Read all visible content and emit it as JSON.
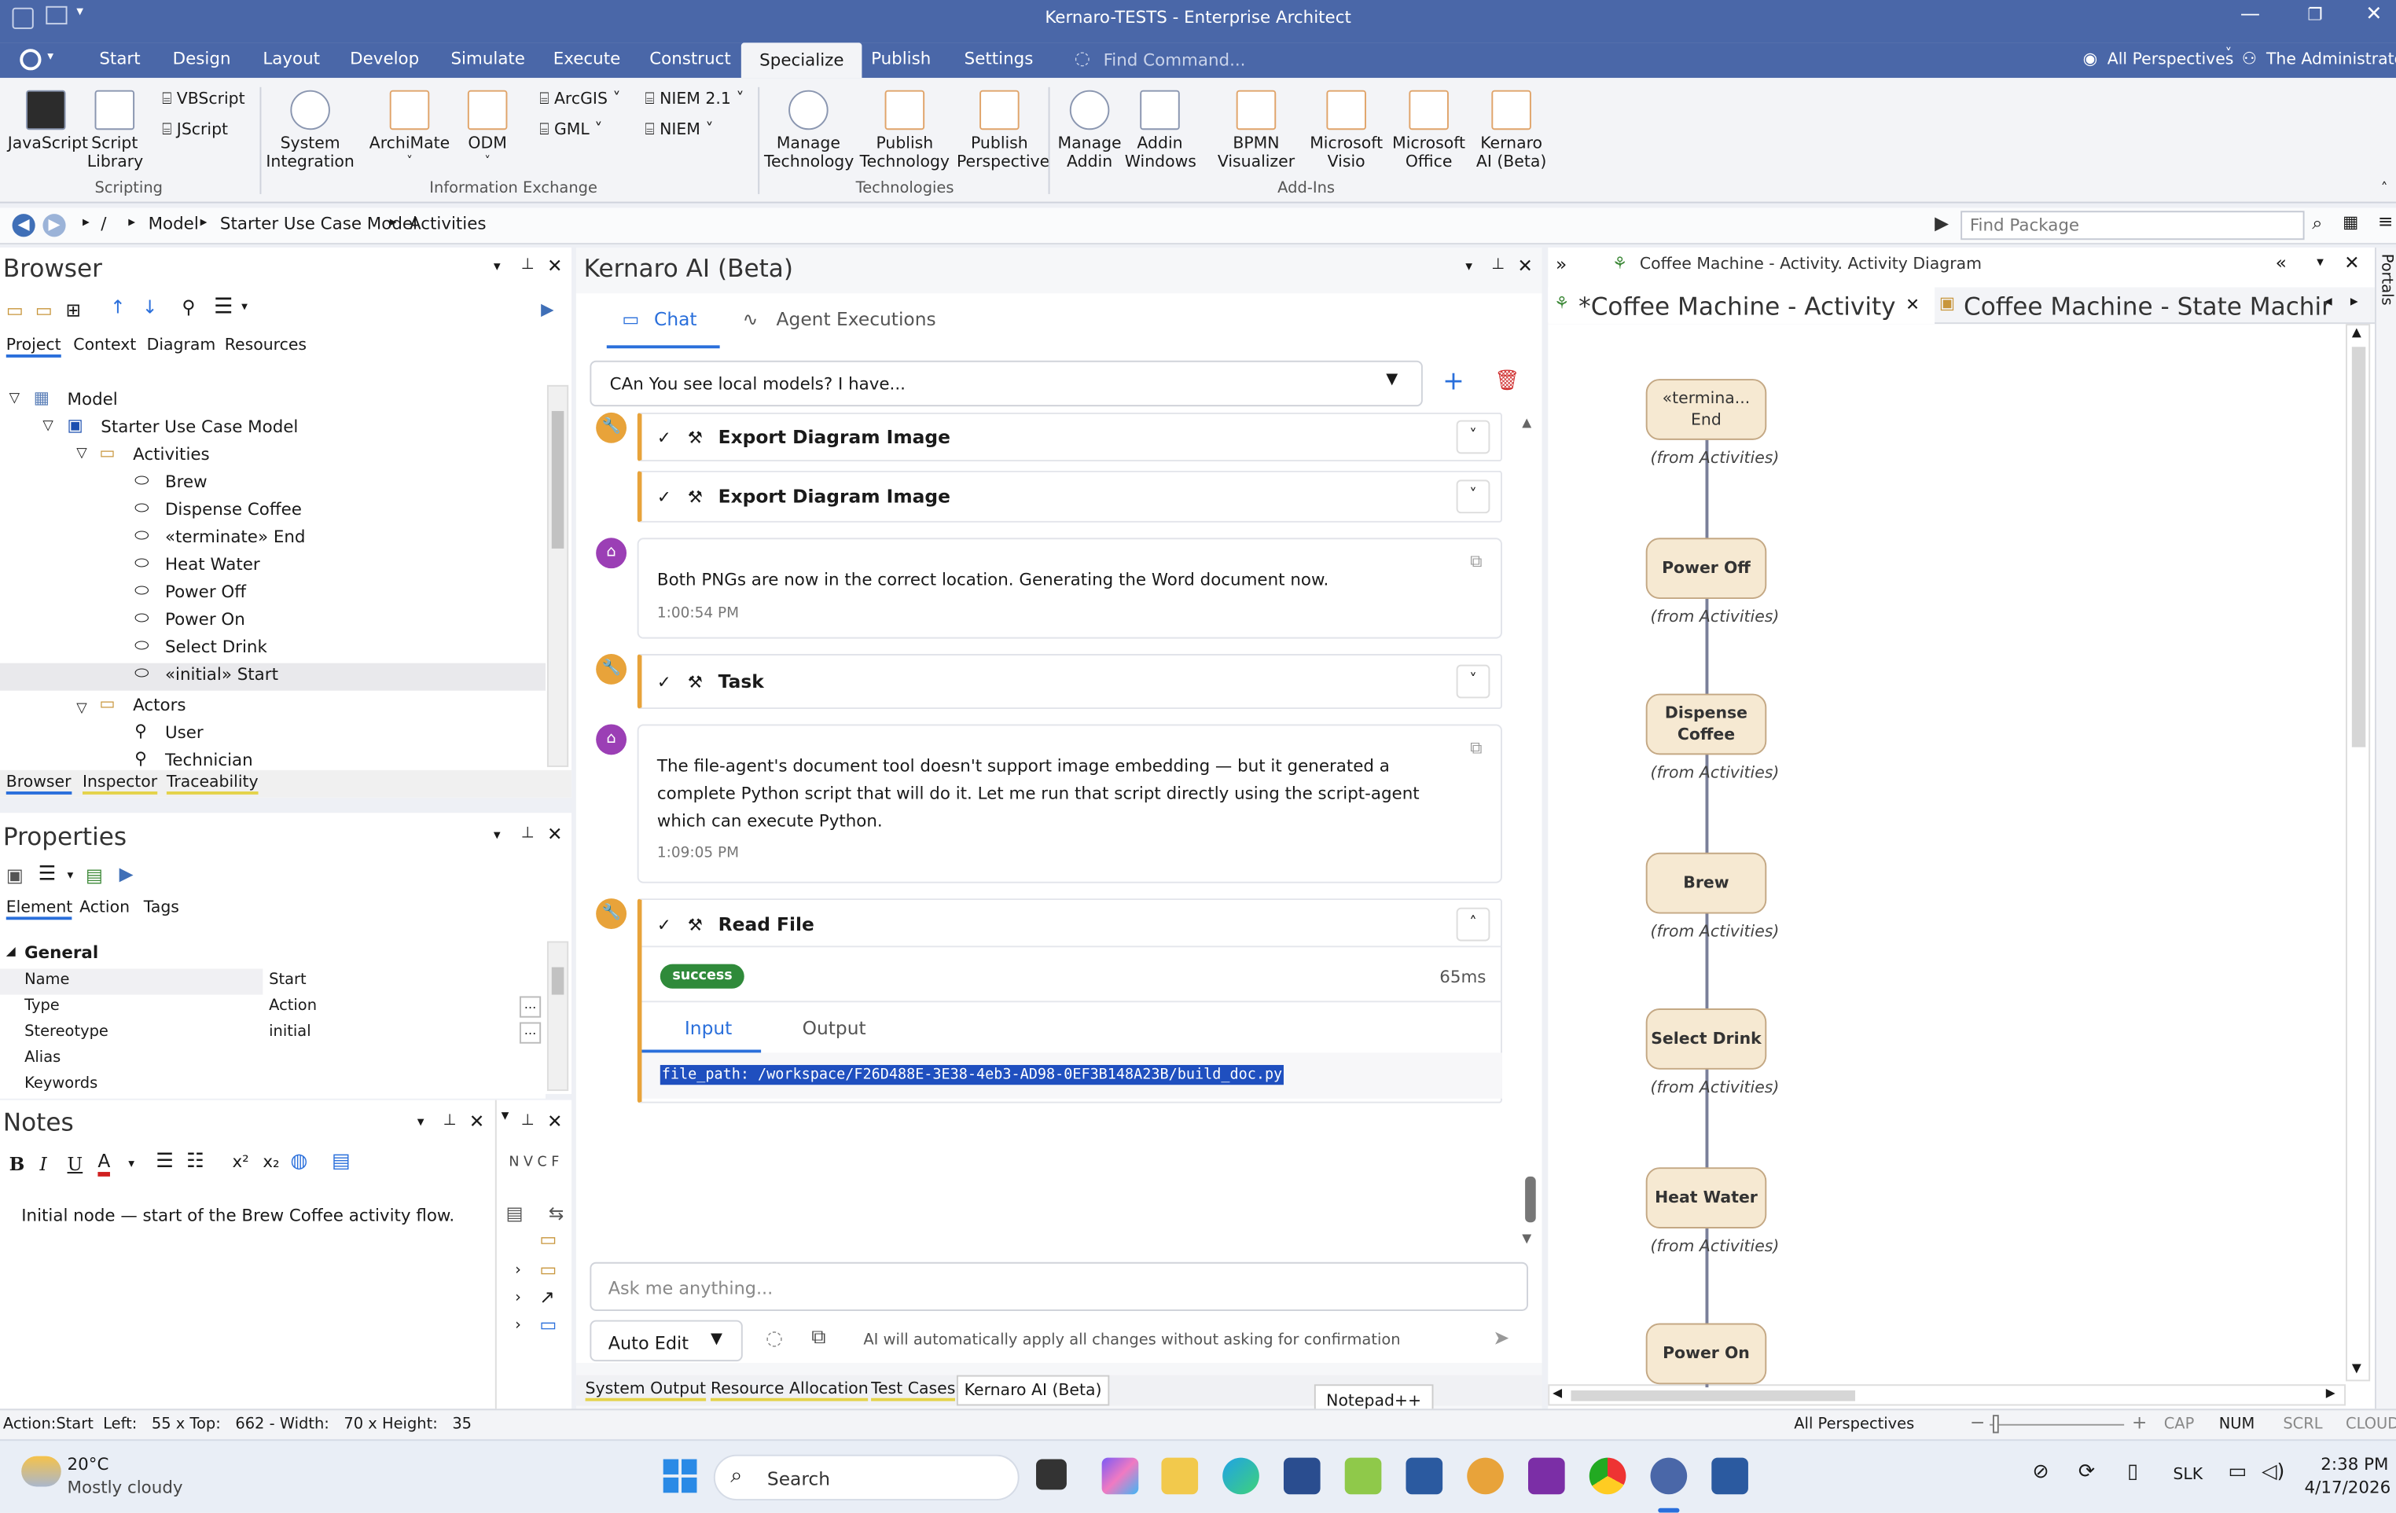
{
  "window": {
    "title": "Kernaro-TESTS - Enterprise Architect"
  },
  "ribbon_tabs": [
    "Start",
    "Design",
    "Layout",
    "Develop",
    "Simulate",
    "Execute",
    "Construct",
    "Specialize",
    "Publish",
    "Settings"
  ],
  "find_command_placeholder": "Find Command...",
  "perspectives": "All Perspectives",
  "user": "The Administrator",
  "ribbon": {
    "javascript": "JavaScript",
    "script_library": "Script\nLibrary",
    "vbscript": "VBScript",
    "jscript": "JScript",
    "scripting_label": "Scripting",
    "system_integration": "System\nIntegration",
    "archimate": "ArchiMate",
    "odm": "ODM",
    "arcgis": "ArcGIS",
    "gml": "GML",
    "niem21": "NIEM 2.1",
    "niem": "NIEM",
    "info_exchange_label": "Information Exchange",
    "manage_technology": "Manage\nTechnology",
    "publish_technology": "Publish\nTechnology",
    "publish_perspective": "Publish\nPerspective",
    "technologies_label": "Technologies",
    "manage_addin": "Manage\nAddin",
    "addin_windows": "Addin\nWindows",
    "bpmn_visualizer": "BPMN\nVisualizer",
    "microsoft_visio": "Microsoft\nVisio",
    "microsoft_office": "Microsoft\nOffice",
    "kernaro_ai": "Kernaro\nAI (Beta)",
    "addins_label": "Add-Ins"
  },
  "breadcrumb": [
    "/",
    "Model",
    "Starter Use Case Model",
    "Activities"
  ],
  "find_package_placeholder": "Find Package",
  "browser": {
    "title": "Browser",
    "tabs": [
      "Project",
      "Context",
      "Diagram",
      "Resources"
    ],
    "tree": {
      "model": "Model",
      "starter": "Starter Use Case Model",
      "activities": "Activities",
      "items": [
        "Brew",
        "Dispense Coffee",
        "«terminate» End",
        "Heat Water",
        "Power Off",
        "Power On",
        "Select Drink",
        "«initial» Start"
      ],
      "actors": "Actors",
      "actor_items": [
        "User",
        "Technician"
      ]
    },
    "bottom_tabs": [
      "Browser",
      "Inspector",
      "Traceability"
    ]
  },
  "properties": {
    "title": "Properties",
    "tabs": [
      "Element",
      "Action",
      "Tags"
    ],
    "section": "General",
    "rows": [
      {
        "k": "Name",
        "v": "Start"
      },
      {
        "k": "Type",
        "v": "Action"
      },
      {
        "k": "Stereotype",
        "v": "initial"
      },
      {
        "k": "Alias",
        "v": ""
      },
      {
        "k": "Keywords",
        "v": ""
      }
    ]
  },
  "notes": {
    "title": "Notes",
    "text": "Initial node — start of the Brew Coffee activity flow.",
    "side_letters": "N V C F"
  },
  "ai": {
    "title": "Kernaro AI (Beta)",
    "tab_chat": "Chat",
    "tab_agent": "Agent Executions",
    "conversation": "CAn You see local models? I have...",
    "tool1": "Export Diagram Image",
    "tool2": "Export Diagram Image",
    "msg1": "Both PNGs are now in the correct location. Generating the Word document now.",
    "msg1_time": "1:00:54 PM",
    "tool3": "Task",
    "msg2": "The file-agent's document tool doesn't support image embedding — but it generated a complete Python script that will do it. Let me run that script directly using the script-agent which can execute Python.",
    "msg2_time": "1:09:05 PM",
    "tool4": "Read File",
    "status": "success",
    "duration": "65ms",
    "io_input": "Input",
    "io_output": "Output",
    "code": "file_path: /workspace/F26D488E-3E38-4eb3-AD98-0EF3B148A23B/build_doc.py",
    "ask_placeholder": "Ask me anything...",
    "mode": "Auto Edit",
    "hint": "AI will automatically apply all changes without asking for confirmation"
  },
  "bottom_tabs": [
    "System Output",
    "Resource Allocation",
    "Test Cases",
    "Kernaro AI (Beta)"
  ],
  "notepad_tooltip": "Notepad++",
  "diagram": {
    "header": "Coffee Machine - Activity.  Activity Diagram",
    "tab1": "*Coffee Machine - Activity",
    "tab2": "Coffee Machine - State Machir",
    "nodes": [
      "«termina...\nEnd",
      "Power Off",
      "Dispense\nCoffee",
      "Brew",
      "Select Drink",
      "Heat Water",
      "Power On"
    ],
    "from_label": "(from Activities)",
    "portals": "Portals"
  },
  "statusbar": {
    "left": "Action:Start  Left:   55 x Top:   662 - Width:   70 x Height:   35",
    "perspectives": "All Perspectives",
    "caps": [
      "CAP",
      "NUM",
      "SCRL",
      "CLOUD"
    ]
  },
  "taskbar": {
    "temp": "20°C",
    "weather": "Mostly cloudy",
    "search": "Search",
    "lang": "SLK",
    "time": "2:38 PM",
    "date": "4/17/2026"
  },
  "colors": {
    "titlebar": "#4a67a8",
    "accent": "#2a6fdb",
    "tool_border": "#e8a33a",
    "agent": "#9b3fb5",
    "success": "#2f8a3a"
  }
}
